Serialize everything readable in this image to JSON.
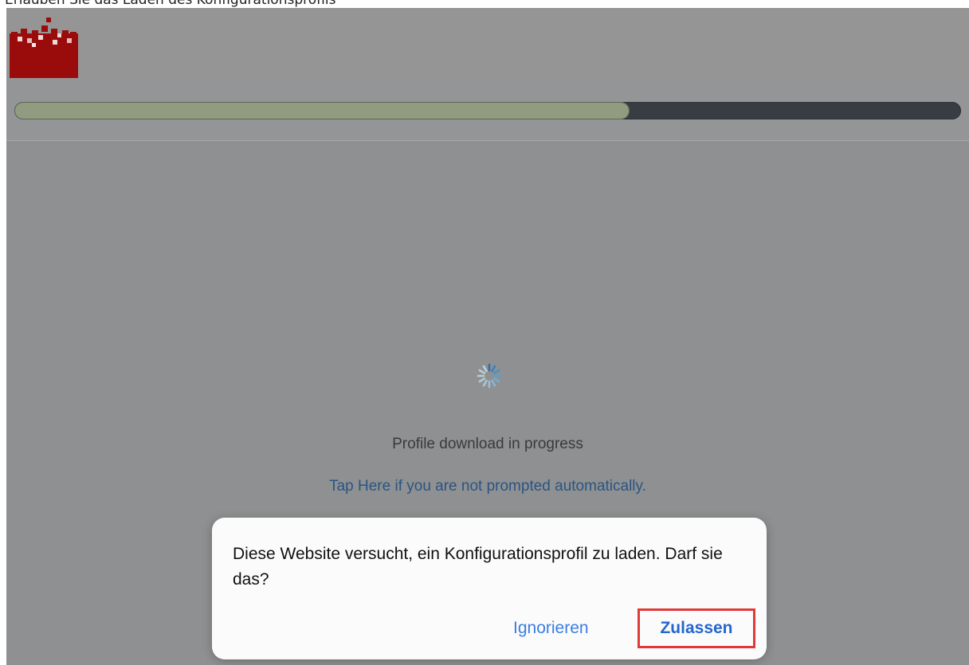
{
  "caption": "Erlauben Sie das Laden des Konfigurationsprofils",
  "header": {
    "logo_icon": "brand-logo-icon",
    "brand_color": "#9a0c0c"
  },
  "progress": {
    "value": 0.65,
    "fill_color": "#919b80",
    "track_color": "#383d43"
  },
  "main": {
    "spinner_icon": "loading-spinner-icon",
    "status_text": "Profile download in progress",
    "tap_link": "Tap Here if you are not prompted automatically."
  },
  "dialog": {
    "message": "Diese Website versucht, ein Konfigurationsprofil zu laden. Darf sie das?",
    "ignore_label": "Ignorieren",
    "allow_label": "Zulassen",
    "highlight_color": "#e0393a"
  }
}
